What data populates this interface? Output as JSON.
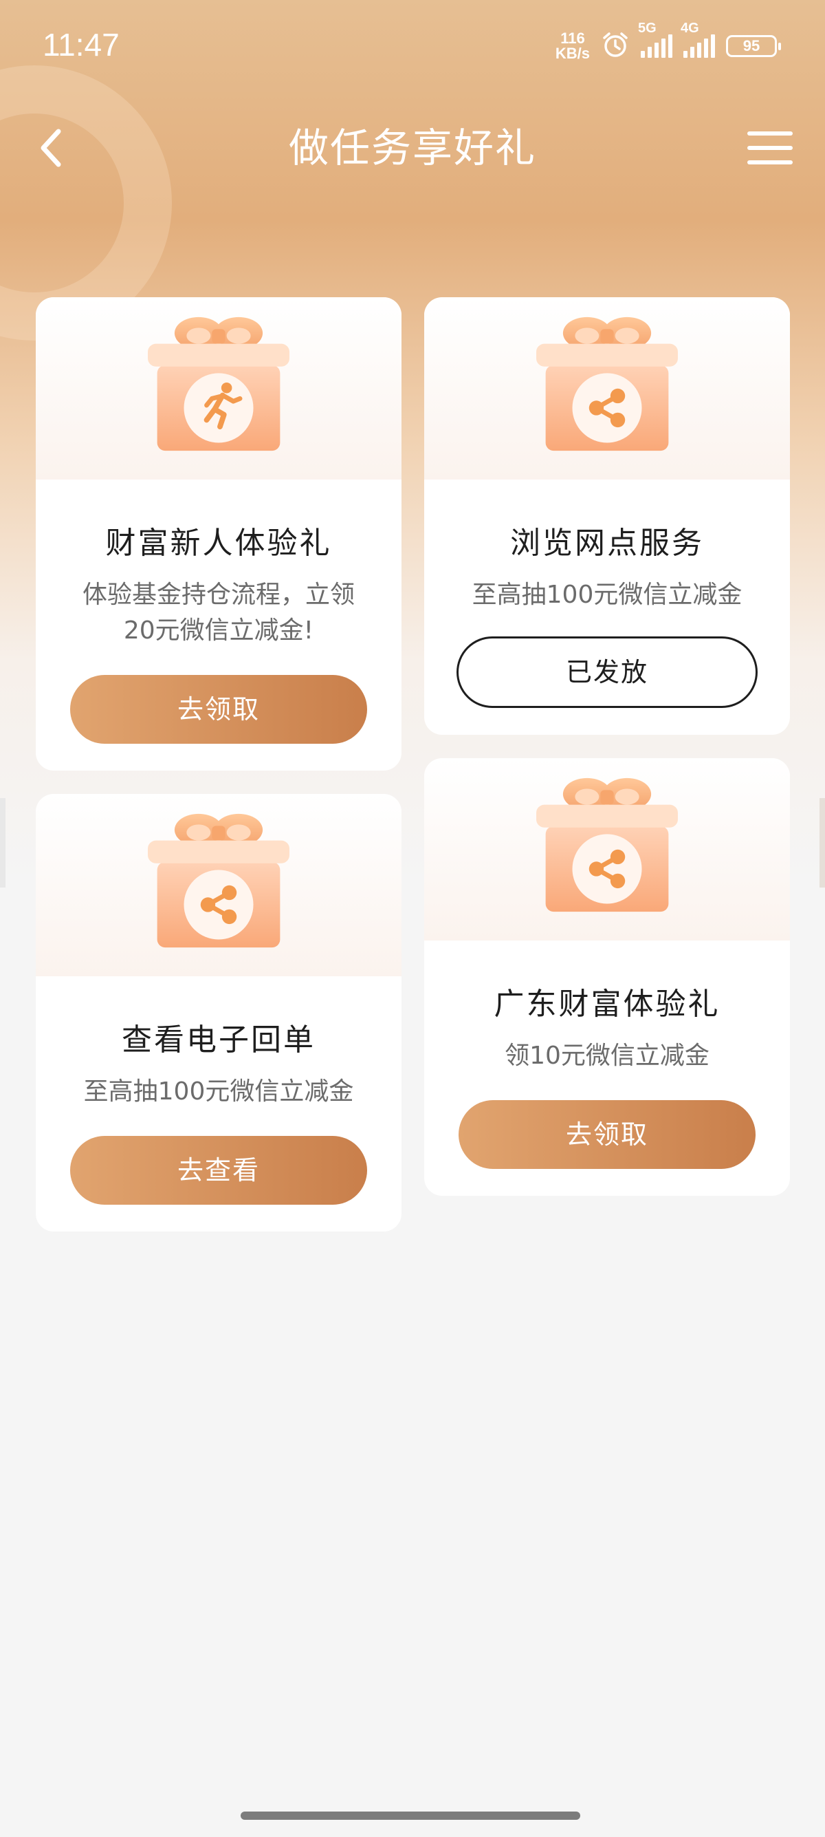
{
  "status_bar": {
    "time": "11:47",
    "net_speed_value": "116",
    "net_speed_unit": "KB/s",
    "signal_1_label": "5G",
    "signal_2_label": "4G",
    "battery": "95",
    "icons": [
      "alarm-icon",
      "signal-icon",
      "battery-icon"
    ]
  },
  "header": {
    "title": "做任务享好礼",
    "back_icon": "chevron-left-icon",
    "menu_icon": "hamburger-menu-icon"
  },
  "tasks": [
    {
      "title": "财富新人体验礼",
      "description": "体验基金持仓流程，立领20元微信立减金!",
      "button_label": "去领取",
      "button_style": "filled",
      "icon": "running-person-icon"
    },
    {
      "title": "浏览网点服务",
      "description": "至高抽100元微信立减金",
      "button_label": "已发放",
      "button_style": "outline",
      "icon": "share-icon"
    },
    {
      "title": "查看电子回单",
      "description": "至高抽100元微信立减金",
      "button_label": "去查看",
      "button_style": "filled",
      "icon": "share-icon"
    },
    {
      "title": "广东财富体验礼",
      "description": "领10元微信立减金",
      "button_label": "去领取",
      "button_style": "filled",
      "icon": "share-icon"
    }
  ],
  "colors": {
    "header_gradient_top": "#e6bf93",
    "button_gradient_start": "#e1a46f",
    "button_gradient_end": "#c97f4b",
    "gift_box": "#f9b48a",
    "page_background": "#f5f5f5"
  }
}
